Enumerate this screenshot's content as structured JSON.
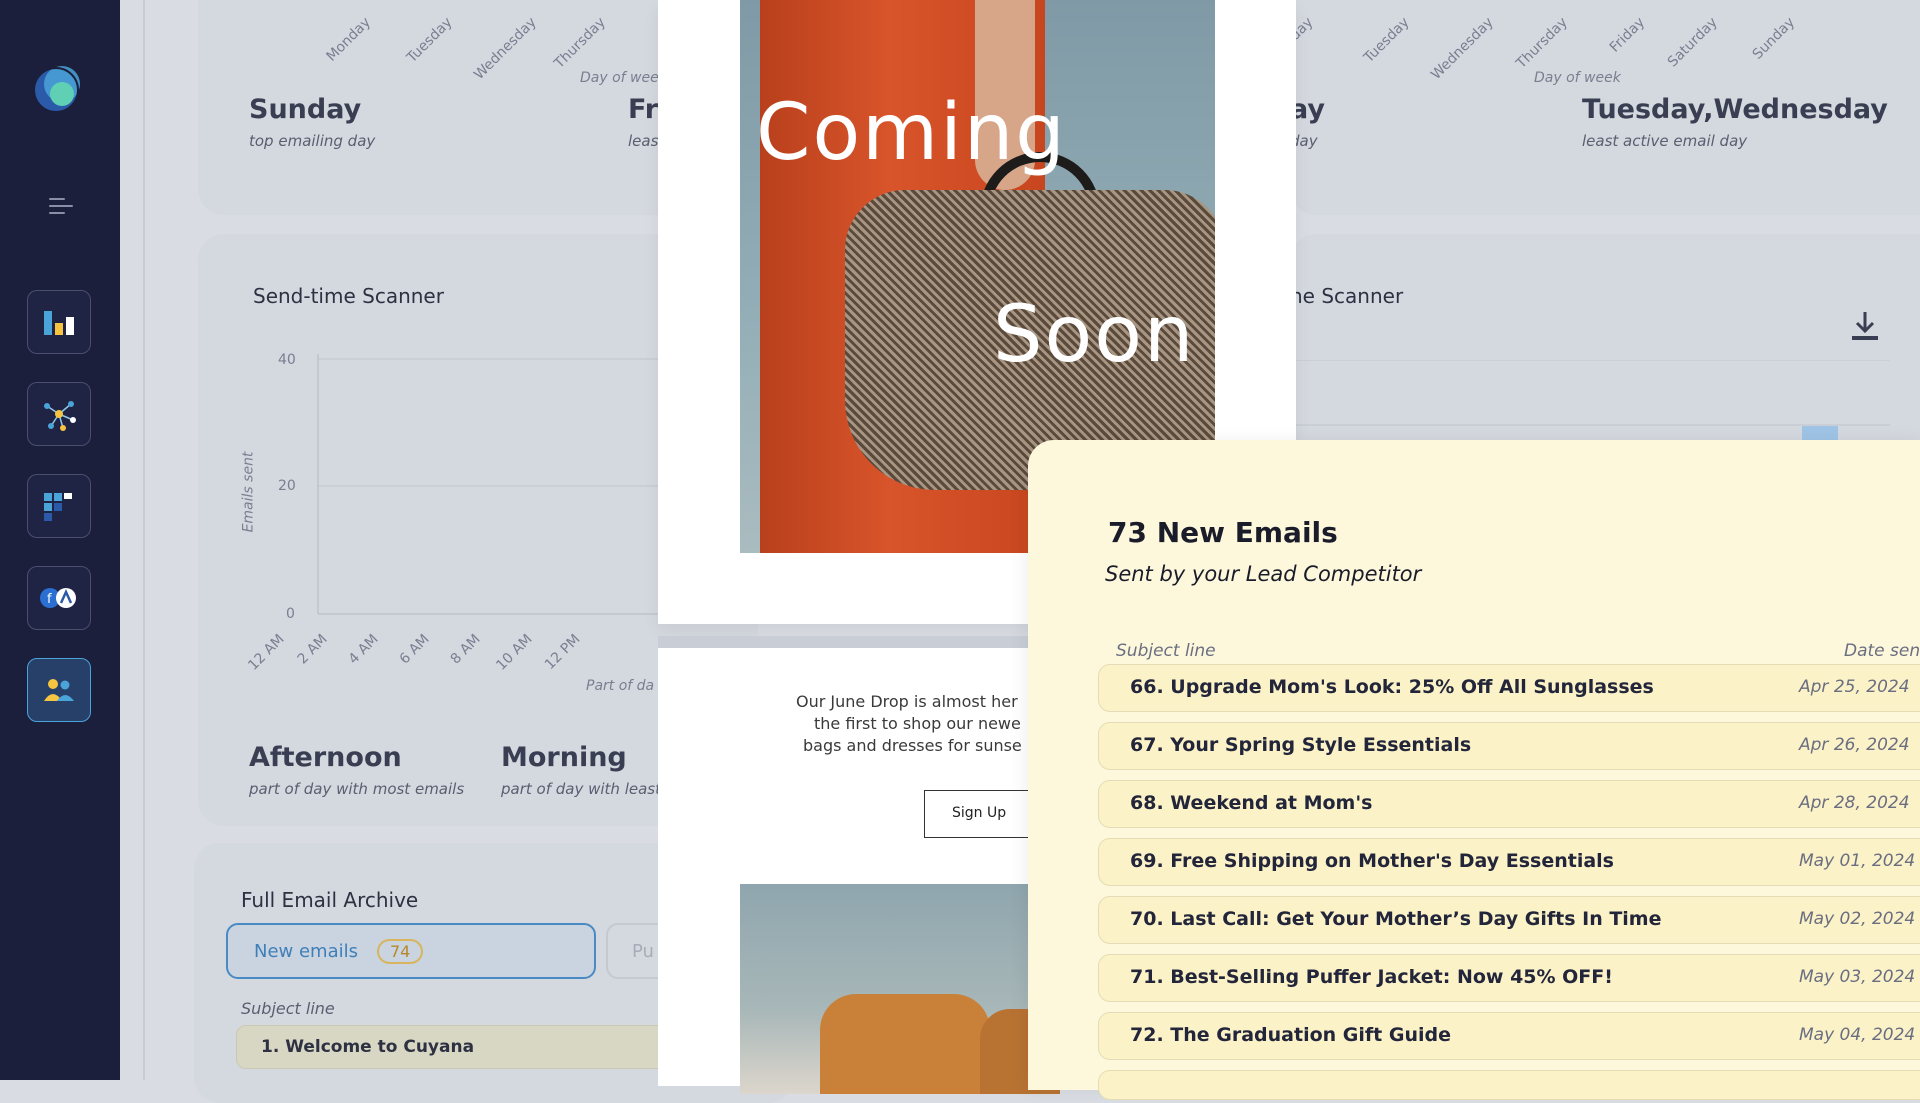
{
  "sidebar": {
    "items": [
      "logo-icon",
      "menu-icon",
      "bar-chart-icon",
      "network-icon",
      "grid-icon",
      "social-icon",
      "people-icon"
    ]
  },
  "days_card": {
    "x_ticks": [
      "Monday",
      "Tuesday",
      "Wednesday",
      "Thursday"
    ],
    "x_axis_label": "Day of wee",
    "top_day": "Sunday",
    "top_day_label": "top emailing day",
    "least_day_partial": "Fri",
    "least_day_label_partial": "leas"
  },
  "days_card_right": {
    "x_ticks": [
      "day",
      "Tuesday",
      "Wednesday",
      "Thursday",
      "Friday",
      "Saturday",
      "Sunday"
    ],
    "x_axis_label": "Day of week",
    "top_day_partial": "ay",
    "top_day_label_partial": "day",
    "least_day": "Tuesday,Wednesday",
    "least_day_label": "least active email day"
  },
  "sendtime_card": {
    "title": "Send-time Scanner",
    "y_axis_label": "Emails sent",
    "y_ticks": [
      "40",
      "20",
      "0"
    ],
    "x_ticks": [
      "12 AM",
      "2 AM",
      "4 AM",
      "6 AM",
      "8 AM",
      "10 AM",
      "12 PM"
    ],
    "x_axis_label": "Part of da",
    "most_part": "Afternoon",
    "most_part_label": "part of day with most emails",
    "least_part": "Morning",
    "least_part_label": "part of day with least"
  },
  "sendtime_card_right": {
    "title_partial": "ne Scanner",
    "download_icon": "download-icon"
  },
  "archive": {
    "title": "Full Email Archive",
    "tab_new": "New emails",
    "tab_new_count": "74",
    "tab_other_partial": "Pu",
    "col_subject": "Subject line",
    "first_row": "1. Welcome to Cuyana"
  },
  "email_preview": {
    "hero_word1": "Coming",
    "hero_word2": "Soon",
    "body_line1": "Our June Drop is almost her",
    "body_line2": "the first to shop our newe",
    "body_line3": "bags and dresses for sunse",
    "cta": "Sign Up"
  },
  "new_emails": {
    "heading": "73 New Emails",
    "subheading": "Sent by your Lead Competitor",
    "col_subject": "Subject line",
    "col_date": "Date sen",
    "rows": [
      {
        "subject": "66. Upgrade Mom's Look: 25% Off All Sunglasses",
        "date": "Apr 25, 2024"
      },
      {
        "subject": "67. Your Spring Style Essentials",
        "date": "Apr 26, 2024"
      },
      {
        "subject": "68. Weekend at Mom's",
        "date": "Apr 28, 2024"
      },
      {
        "subject": "69. Free Shipping on Mother's Day Essentials",
        "date": "May 01, 2024"
      },
      {
        "subject": "70. Last Call: Get Your Mother’s Day Gifts In Time",
        "date": "May 02, 2024"
      },
      {
        "subject": "71. Best-Selling Puffer Jacket: Now 45% OFF!",
        "date": "May 03, 2024"
      },
      {
        "subject": "72. The Graduation Gift Guide",
        "date": "May 04, 2024"
      }
    ]
  }
}
